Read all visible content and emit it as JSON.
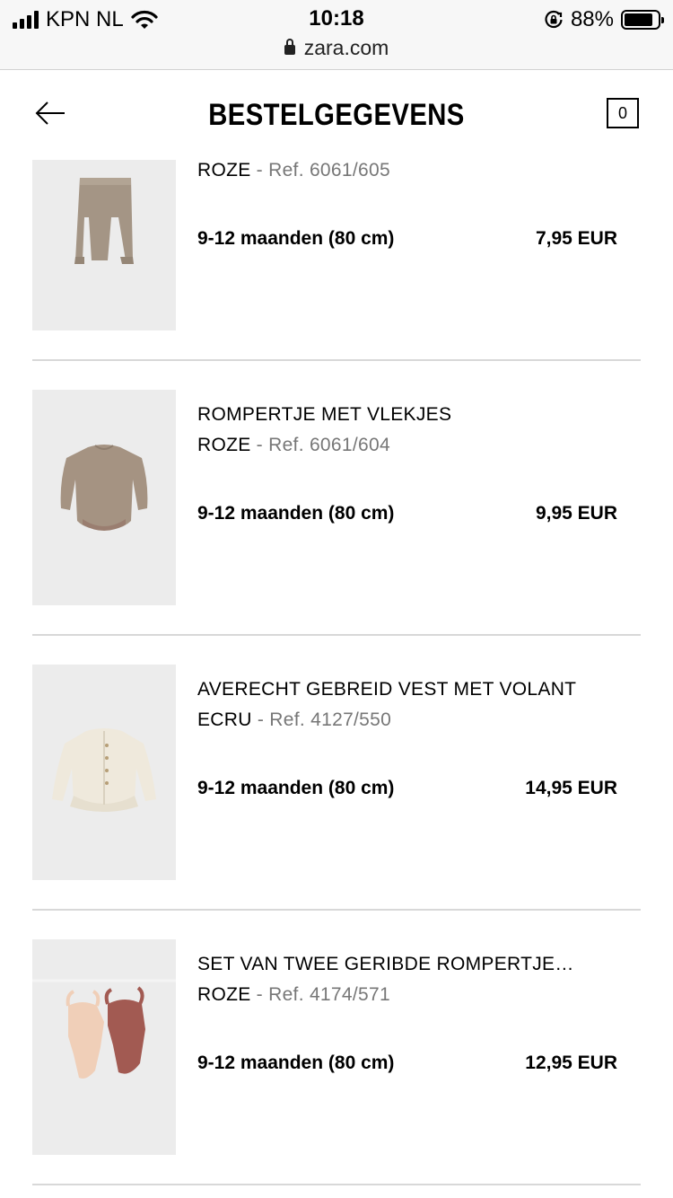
{
  "status": {
    "carrier": "KPN NL",
    "time": "10:18",
    "battery": "88%",
    "url": "zara.com"
  },
  "header": {
    "title": "BESTELGEGEVENS",
    "bag_count": "0"
  },
  "items": [
    {
      "name": "",
      "color": "ROZE",
      "sep": " - ",
      "ref": "Ref. 6061/605",
      "size": "9-12 maanden (80 cm)",
      "price": "7,95 EUR"
    },
    {
      "name": "ROMPERTJE MET VLEKJES",
      "color": "ROZE",
      "sep": " - ",
      "ref": "Ref. 6061/604",
      "size": "9-12 maanden (80 cm)",
      "price": "9,95 EUR"
    },
    {
      "name": "AVERECHT GEBREID VEST MET VOLANT",
      "color": "ECRU",
      "sep": " - ",
      "ref": "Ref. 4127/550",
      "size": "9-12 maanden (80 cm)",
      "price": "14,95 EUR"
    },
    {
      "name": "SET VAN TWEE GERIBDE ROMPERTJE…",
      "color": "ROZE",
      "sep": " - ",
      "ref": "Ref. 4174/571",
      "size": "9-12 maanden (80 cm)",
      "price": "12,95 EUR"
    }
  ],
  "icons": {
    "back": "arrow-left-icon",
    "bag": "shopping-bag-icon",
    "signal": "cellular-signal-icon",
    "wifi": "wifi-icon",
    "lock": "lock-icon",
    "orientation": "orientation-lock-icon",
    "battery": "battery-icon"
  }
}
